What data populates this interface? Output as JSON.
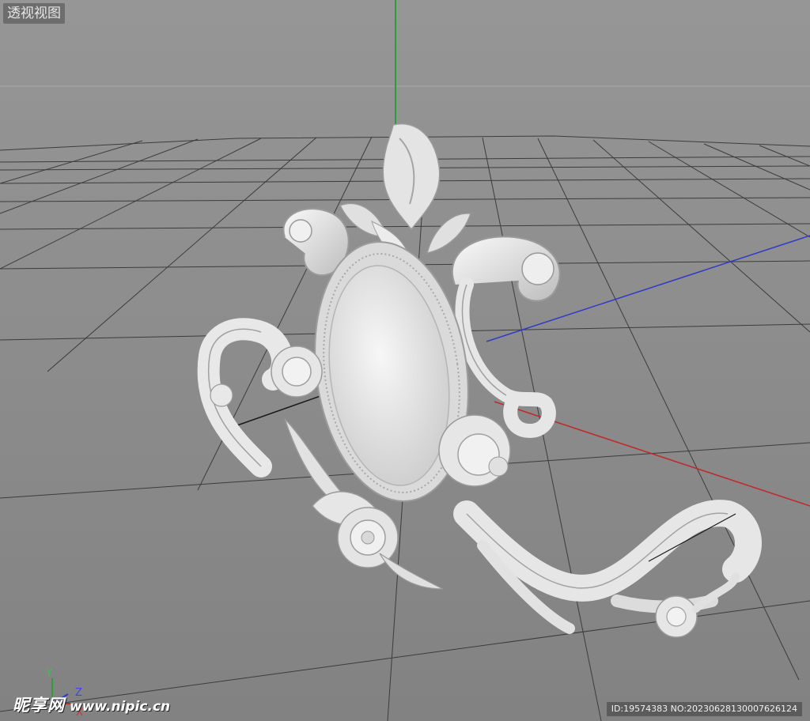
{
  "viewport": {
    "label": "透视视图",
    "colors": {
      "background": "#8f8f8f",
      "grid": "#3a3a3a",
      "axis_x": "#c0282a",
      "axis_y": "#2f9b3a",
      "axis_z": "#2f3ac8",
      "model": "#e8e8e8"
    }
  },
  "axis_gizmo": {
    "y_label": "Y",
    "x_label": "X",
    "z_label": "Z"
  },
  "watermark": {
    "logo": "昵享网",
    "site": "www.nipic.cn"
  },
  "image_id": "ID:19574383 NO:20230628130007626124",
  "icons": [
    "axis-gizmo-icon"
  ]
}
